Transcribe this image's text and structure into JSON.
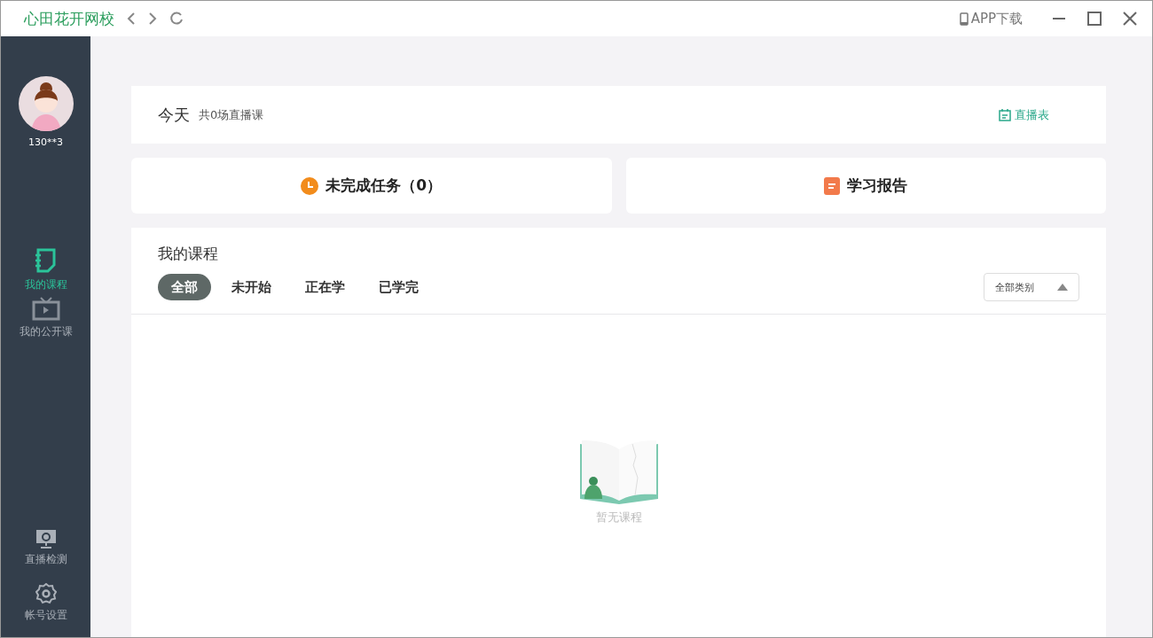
{
  "window": {
    "title": "心田花开网校",
    "app_download": "APP下载"
  },
  "user": {
    "name": "130**3"
  },
  "sidebar": {
    "items": [
      {
        "kind": "courses",
        "label": "我的课程",
        "selected": true
      },
      {
        "kind": "public",
        "label": "我的公开课",
        "selected": false
      }
    ],
    "bottom_items": [
      {
        "kind": "live_check",
        "label": "直播检测"
      },
      {
        "kind": "settings",
        "label": "帐号设置"
      }
    ]
  },
  "today": {
    "title": "今天",
    "subtitle": "共0场直播课",
    "schedule_link": "直播表"
  },
  "tasks": {
    "label": "未完成任务（0）"
  },
  "report": {
    "label": "学习报告"
  },
  "courses": {
    "title": "我的课程",
    "tabs": [
      {
        "label": "全部",
        "selected": true
      },
      {
        "label": "未开始",
        "selected": false
      },
      {
        "label": "正在学",
        "selected": false
      },
      {
        "label": "已学完",
        "selected": false
      }
    ],
    "category": {
      "value": "全部类别"
    },
    "empty_text": "暂无课程"
  }
}
